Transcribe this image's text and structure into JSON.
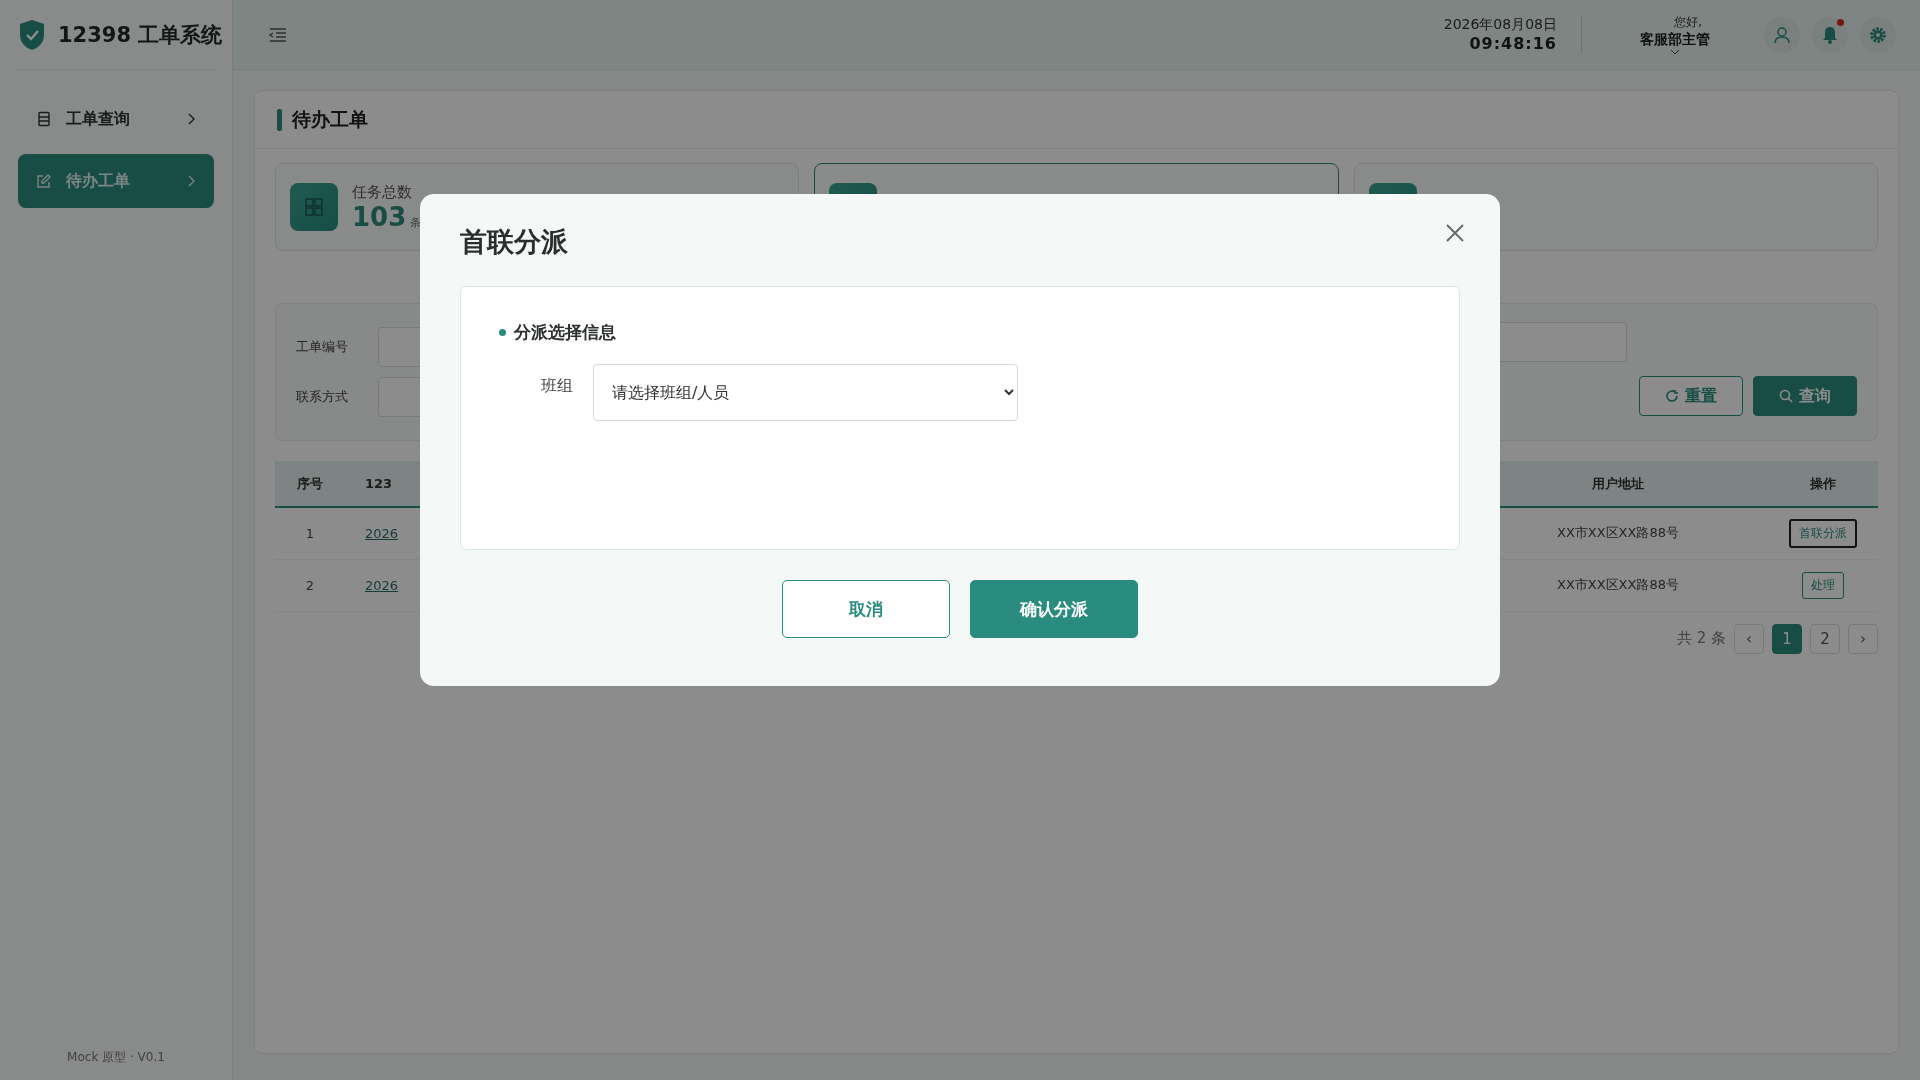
{
  "brand": {
    "title": "12398 工单系统"
  },
  "sidebar": {
    "items": [
      {
        "label": "工单查询",
        "selected": false
      },
      {
        "label": "待办工单",
        "selected": true
      }
    ],
    "footer": "Mock 原型 · V0.1"
  },
  "header": {
    "date": "2026年08月08日",
    "time": "09:48:16",
    "greeting": "您好,",
    "user": "客服部主管",
    "notifications_unread": true
  },
  "page": {
    "title": "待办工单",
    "stat_cards": [
      {
        "label": "任务总数",
        "value": "103",
        "unit": "条",
        "selected": false
      },
      {
        "selected": true
      },
      {
        "selected": false
      }
    ],
    "filters": [
      {
        "label": "工单编号"
      },
      {
        "label": "联系方式"
      }
    ],
    "buttons": {
      "reset": "重置",
      "search": "查询"
    },
    "table": {
      "columns": [
        "序号",
        "123",
        "用户地址",
        "操作"
      ],
      "rows": [
        {
          "index": "1",
          "column_2": "2026",
          "address": "XX市XX区XX路88号",
          "action": "首联分派",
          "focused": true
        },
        {
          "index": "2",
          "column_2": "2026",
          "address": "XX市XX区XX路88号",
          "action": "处理",
          "focused": false
        }
      ]
    },
    "pagination": {
      "total": "共 2 条",
      "prev": "‹",
      "next": "›",
      "pages": [
        {
          "label": "1",
          "selected": true
        },
        {
          "label": "2",
          "selected": false
        }
      ]
    }
  },
  "dialog": {
    "title": "首联分派",
    "section": "分派选择信息",
    "field_label": "班组",
    "select_placeholder": "请选择班组/人员",
    "cancel": "取消",
    "confirm": "确认分派"
  }
}
